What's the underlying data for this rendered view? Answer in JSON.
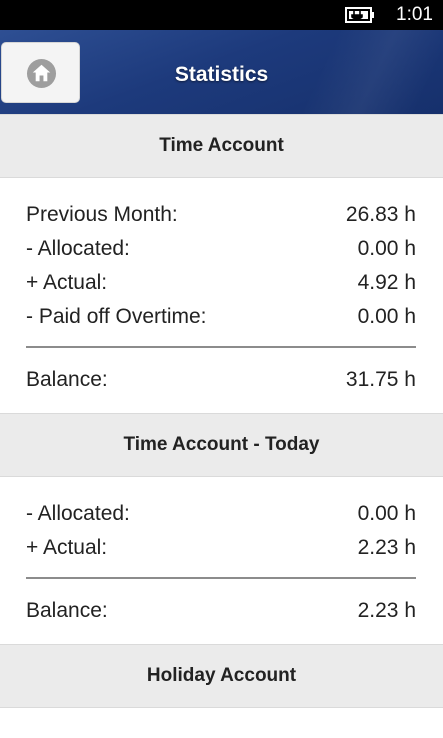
{
  "status_bar": {
    "time": "1:01",
    "battery_icon": "battery-charging-icon"
  },
  "header": {
    "title": "Statistics",
    "home_icon": "home-icon"
  },
  "time_account": {
    "title": "Time Account",
    "rows": [
      {
        "label": "Previous Month:",
        "value": "26.83 h"
      },
      {
        "label": "- Allocated:",
        "value": "0.00 h"
      },
      {
        "label": "+ Actual:",
        "value": "4.92 h"
      },
      {
        "label": "- Paid off Overtime:",
        "value": "0.00 h"
      }
    ],
    "balance": {
      "label": "Balance:",
      "value": "31.75 h"
    }
  },
  "time_account_today": {
    "title": "Time Account - Today",
    "rows": [
      {
        "label": "- Allocated:",
        "value": "0.00 h"
      },
      {
        "label": "+ Actual:",
        "value": "2.23 h"
      }
    ],
    "balance": {
      "label": "Balance:",
      "value": "2.23 h"
    }
  },
  "holiday_account": {
    "title": "Holiday Account"
  }
}
